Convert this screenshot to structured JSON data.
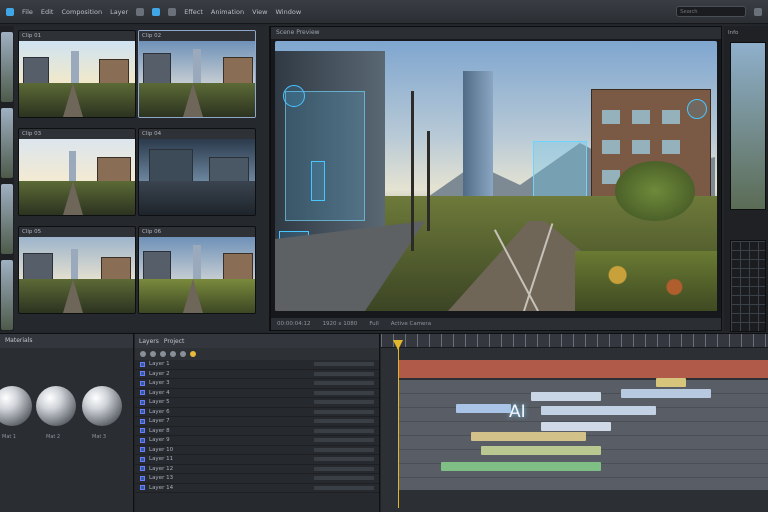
{
  "topbar": {
    "menus": [
      "File",
      "Edit",
      "Composition",
      "Layer",
      "Effect",
      "Animation",
      "View",
      "Window"
    ],
    "search_placeholder": "Search"
  },
  "thumbs": {
    "captions": [
      "Clip 01",
      "Clip 02",
      "Clip 03",
      "Clip 04",
      "Clip 05",
      "Clip 06"
    ]
  },
  "viewer": {
    "header": "Scene Preview",
    "footer": [
      "00:00:04:12",
      "1920 x 1080",
      "Full",
      "Active Camera"
    ]
  },
  "right_col": {
    "label": "Info"
  },
  "materials": {
    "title": "Materials",
    "items": [
      "Mat 1",
      "Mat 2",
      "Mat 3"
    ]
  },
  "layers": {
    "title": "Layers",
    "tab2": "Project",
    "rows": [
      "Layer 1",
      "Layer 2",
      "Layer 3",
      "Layer 4",
      "Layer 5",
      "Layer 6",
      "Layer 7",
      "Layer 8",
      "Layer 9",
      "Layer 10",
      "Layer 11",
      "Layer 12",
      "Layer 13",
      "Layer 14"
    ]
  },
  "timeline": {
    "overlay_label": "AI"
  },
  "colors": {
    "accent": "#3fa7e8",
    "playhead": "#e0b62b",
    "track_red": "#c8614f",
    "holo": "#47c6ff"
  }
}
